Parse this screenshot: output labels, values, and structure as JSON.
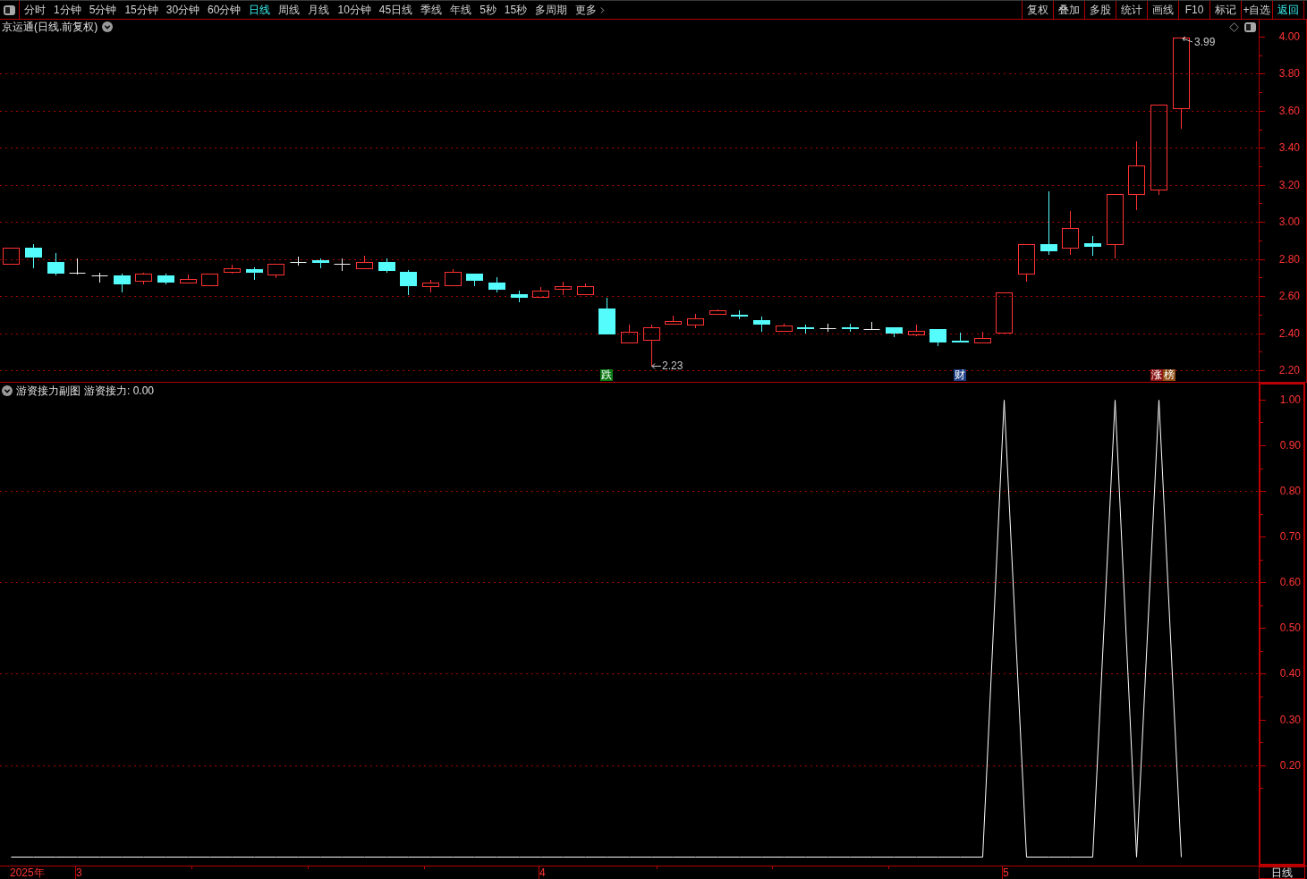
{
  "toolbar": {
    "tabs": [
      {
        "label": "分时",
        "selected": false,
        "kind": "period"
      },
      {
        "label": "1分钟",
        "selected": false,
        "kind": "period"
      },
      {
        "label": "5分钟",
        "selected": false,
        "kind": "period"
      },
      {
        "label": "15分钟",
        "selected": false,
        "kind": "period"
      },
      {
        "label": "30分钟",
        "selected": false,
        "kind": "period"
      },
      {
        "label": "60分钟",
        "selected": false,
        "kind": "period"
      },
      {
        "label": "日线",
        "selected": true,
        "kind": "period"
      },
      {
        "label": "周线",
        "selected": false,
        "kind": "period"
      },
      {
        "label": "月线",
        "selected": false,
        "kind": "period"
      },
      {
        "label": "10分钟",
        "selected": false,
        "kind": "period"
      },
      {
        "label": "45日线",
        "selected": false,
        "kind": "period"
      },
      {
        "label": "季线",
        "selected": false,
        "kind": "period"
      },
      {
        "label": "年线",
        "selected": false,
        "kind": "period"
      },
      {
        "label": "5秒",
        "selected": false,
        "kind": "period"
      },
      {
        "label": "15秒",
        "selected": false,
        "kind": "period"
      },
      {
        "label": "多周期",
        "selected": false,
        "kind": "period"
      },
      {
        "label": "更多",
        "selected": false,
        "kind": "menu"
      }
    ],
    "actions": [
      {
        "label": "复权",
        "highlighted": false
      },
      {
        "label": "叠加",
        "highlighted": false
      },
      {
        "label": "多股",
        "highlighted": false
      },
      {
        "label": "统计",
        "highlighted": false
      },
      {
        "label": "画线",
        "highlighted": false
      },
      {
        "label": "F10",
        "highlighted": false
      },
      {
        "label": "标记",
        "highlighted": false
      },
      {
        "label": "+自选",
        "highlighted": false
      },
      {
        "label": "返回",
        "highlighted": true
      }
    ]
  },
  "price_chart": {
    "title": "京运通(日线.前复权)",
    "axis_labels": [
      "4.00",
      "3.80",
      "3.60",
      "3.40",
      "3.20",
      "3.00",
      "2.80",
      "2.60",
      "2.40",
      "2.20"
    ],
    "price_marks": [
      "3.99",
      "2.23"
    ],
    "event_tags": [
      {
        "parts": [
          {
            "text": "跌",
            "color": "#0b7a12"
          }
        ]
      },
      {
        "parts": [
          {
            "text": "财",
            "color": "#1f3f85"
          }
        ]
      },
      {
        "parts": [
          {
            "text": "涨",
            "color": "#8e1616"
          },
          {
            "text": "榜",
            "color": "#8f4d12"
          }
        ]
      }
    ]
  },
  "indicator_panel": {
    "title": "游资接力副图",
    "legend": "游资接力: 0.00",
    "chart_data": {
      "type": "line",
      "grid": true,
      "ylim": [
        -0.02,
        1.037
      ],
      "yticks": [
        {
          "value": 1,
          "label": "1.00"
        },
        {
          "value": 0.9,
          "label": "0.90"
        },
        {
          "value": 0.8,
          "label": "0.80"
        },
        {
          "value": 0.7,
          "label": "0.70"
        },
        {
          "value": 0.6,
          "label": "0.60"
        },
        {
          "value": 0.5,
          "label": "0.50"
        },
        {
          "value": 0.4,
          "label": "0.40"
        },
        {
          "value": 0.3,
          "label": "0.30"
        },
        {
          "value": 0.2,
          "label": "0.20"
        }
      ],
      "series": [
        {
          "color": "#ffffff",
          "values": [
            0,
            0,
            0,
            0,
            0,
            0,
            0,
            0,
            0,
            0,
            0,
            0,
            0,
            0,
            0,
            0,
            0,
            0,
            0,
            0,
            0,
            0,
            0,
            0,
            0,
            0,
            0,
            0,
            0,
            0,
            0,
            0,
            0,
            0,
            0,
            0,
            0,
            0,
            0,
            0,
            0,
            0,
            0,
            0,
            0,
            1,
            0,
            0,
            0,
            0,
            1,
            0,
            1,
            0
          ]
        }
      ]
    }
  },
  "time_axis": {
    "labels": [
      "2025年",
      "3",
      "4",
      "5"
    ],
    "period": "日线"
  }
}
